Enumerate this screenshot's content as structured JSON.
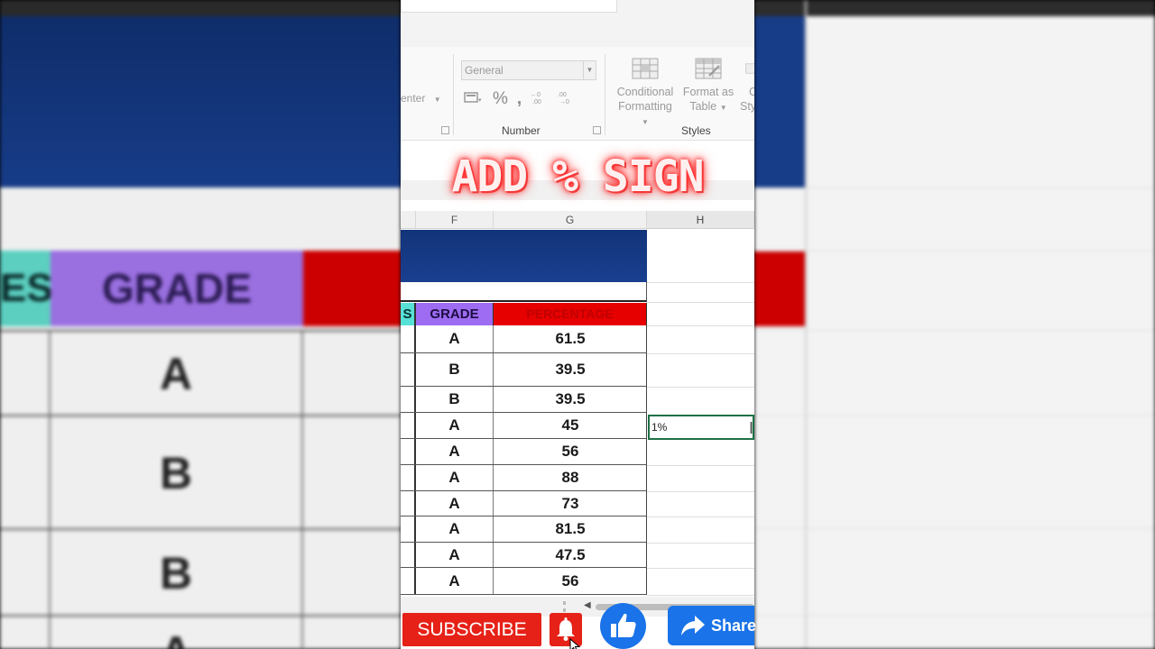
{
  "background": {
    "left_header_partial": "ES",
    "left_header_grade": "GRADE",
    "left_grades": [
      "A",
      "B",
      "B",
      "A"
    ]
  },
  "ribbon": {
    "alignment_partial": "enter",
    "number_format": "General",
    "number_group_label": "Number",
    "styles_group_label": "Styles",
    "conditional_formatting_line1": "Conditional",
    "conditional_formatting_line2": "Formatting",
    "format_as_table_line1": "Format as",
    "format_as_table_line2": "Table",
    "cell_styles_partial_1": "C",
    "cell_styles_partial_2": "Sty"
  },
  "overlay_title": "ADD % SIGN",
  "sheet": {
    "col_headers": [
      "F",
      "G",
      "H"
    ],
    "header_partial": "S",
    "header_grade": "GRADE",
    "header_percentage": "PERCENTAGE",
    "rows": [
      {
        "grade": "A",
        "percentage": "61.5"
      },
      {
        "grade": "B",
        "percentage": "39.5"
      },
      {
        "grade": "B",
        "percentage": "39.5"
      },
      {
        "grade": "A",
        "percentage": "45"
      },
      {
        "grade": "A",
        "percentage": "56"
      },
      {
        "grade": "A",
        "percentage": "88"
      },
      {
        "grade": "A",
        "percentage": "73"
      },
      {
        "grade": "A",
        "percentage": "81.5"
      },
      {
        "grade": "A",
        "percentage": "47.5"
      },
      {
        "grade": "A",
        "percentage": "56"
      }
    ],
    "active_cell_value": "1%"
  },
  "actions": {
    "subscribe_label": "SUBSCRIBE",
    "share_label": "Share"
  },
  "colors": {
    "subscribe_red": "#e62117",
    "like_blue": "#1a73e8",
    "header_purple": "#9d6cf2",
    "header_red": "#e60000",
    "header_cyan": "#56e0d6",
    "title_navy": "#12347a",
    "selection_green": "#1e7145"
  },
  "icons": [
    "bell-icon",
    "thumbs-up-icon",
    "share-arrow-icon",
    "percent-icon",
    "comma-style-icon",
    "accounting-format-icon",
    "increase-decimal-icon",
    "decrease-decimal-icon",
    "conditional-formatting-icon",
    "format-as-table-icon",
    "cursor-icon",
    "i-beam-cursor-icon"
  ]
}
